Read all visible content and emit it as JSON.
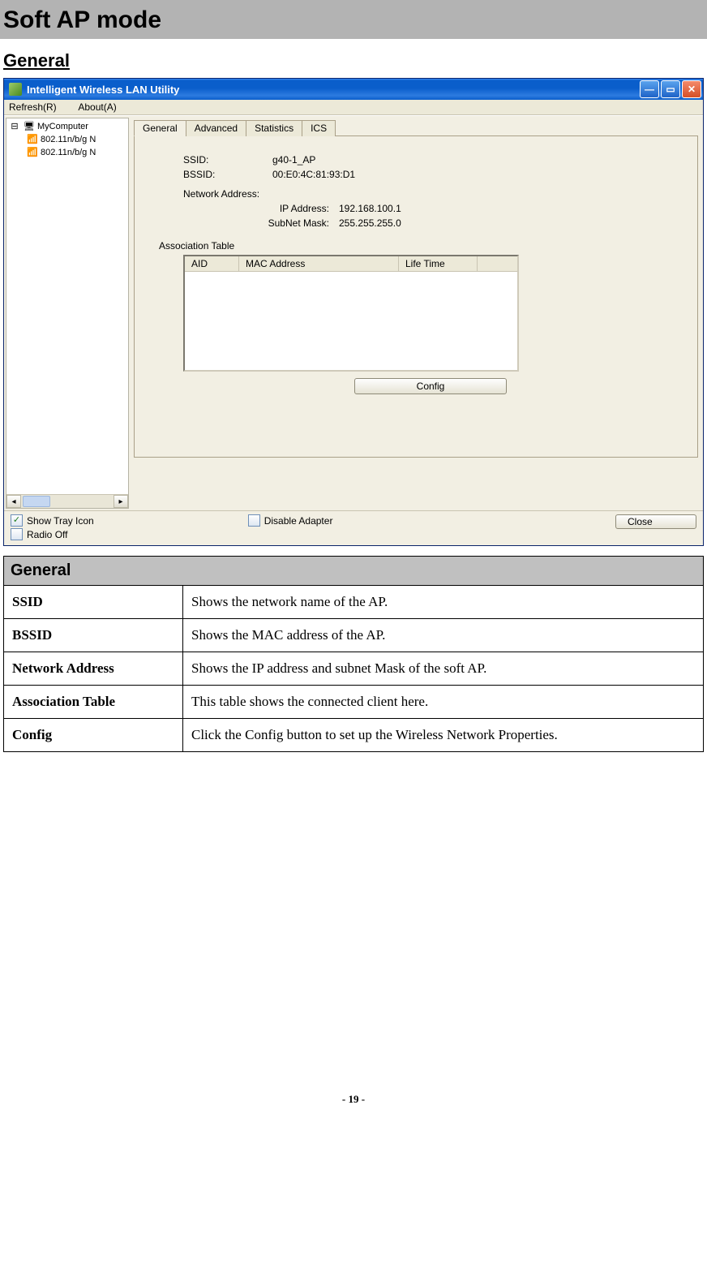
{
  "page_title": "Soft AP mode",
  "section_heading": "General",
  "page_number": "- 19 -",
  "window": {
    "title": "Intelligent Wireless LAN Utility",
    "menu": {
      "refresh": "Refresh(R)",
      "about": "About(A)"
    },
    "tree": {
      "root": "MyComputer",
      "items": [
        "802.11n/b/g N",
        "802.11n/b/g N"
      ]
    },
    "tabs": [
      "General",
      "Advanced",
      "Statistics",
      "ICS"
    ],
    "general": {
      "ssid_label": "SSID:",
      "ssid_value": "g40-1_AP",
      "bssid_label": "BSSID:",
      "bssid_value": "00:E0:4C:81:93:D1",
      "netaddr_label": "Network Address:",
      "ip_label": "IP Address:",
      "ip_value": "192.168.100.1",
      "mask_label": "SubNet Mask:",
      "mask_value": "255.255.255.0",
      "assoc_label": "Association Table",
      "cols": {
        "aid": "AID",
        "mac": "MAC Address",
        "life": "Life Time"
      },
      "config_btn": "Config"
    },
    "checks": {
      "show_tray": "Show Tray Icon",
      "radio_off": "Radio Off",
      "disable_adapter": "Disable Adapter"
    },
    "close_btn": "Close"
  },
  "desc": {
    "header": "General",
    "rows": [
      {
        "k": "SSID",
        "v": "Shows the network name of the AP."
      },
      {
        "k": "BSSID",
        "v": "Shows the MAC address of the AP."
      },
      {
        "k": "Network Address",
        "v": "Shows the IP address and subnet Mask of the soft AP."
      },
      {
        "k": "Association Table",
        "v": "This table shows the connected client here."
      },
      {
        "k": "Config",
        "v": "Click the Config button to set up the Wireless Network Properties."
      }
    ]
  }
}
